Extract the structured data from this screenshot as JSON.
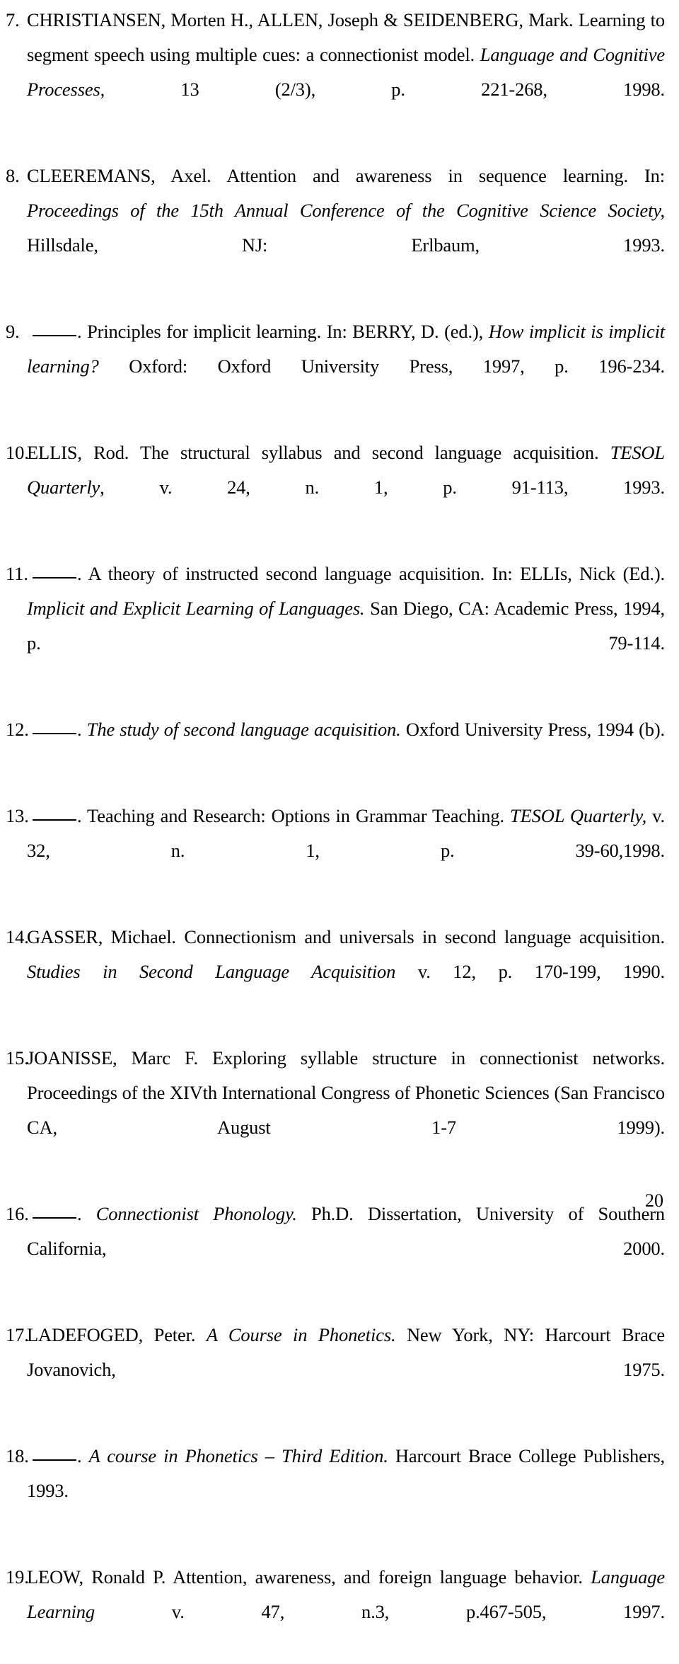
{
  "document": {
    "type": "bibliography",
    "page_number": "20",
    "references": [
      {
        "number": "7.",
        "repeated_author_rule": false,
        "segments": [
          {
            "text": "CHRISTIANSEN, Morten H., ALLEN, Joseph & SEIDENBERG, Mark. Learning to segment speech using multiple cues: a connectionist model. ",
            "style": "roman"
          },
          {
            "text": "Language and Cognitive Processes,",
            "style": "italic"
          },
          {
            "text": " 13 (2/3), p. 221-268, 1998.",
            "style": "roman"
          }
        ]
      },
      {
        "number": "8.",
        "repeated_author_rule": false,
        "segments": [
          {
            "text": "CLEEREMANS, Axel. Attention and awareness in sequence learning. In: ",
            "style": "roman"
          },
          {
            "text": "Proceedings of the 15th Annual Conference of the Cognitive Science Society,",
            "style": "italic"
          },
          {
            "text": " Hillsdale, NJ: Erlbaum, 1993.",
            "style": "roman"
          }
        ]
      },
      {
        "number": "9.",
        "repeated_author_rule": true,
        "segments": [
          {
            "text": ". Principles for implicit learning. In: BERRY, D. (ed.), ",
            "style": "roman"
          },
          {
            "text": "How implicit is implicit learning?",
            "style": "italic"
          },
          {
            "text": " Oxford: Oxford University Press, 1997, p. 196-234.",
            "style": "roman"
          }
        ]
      },
      {
        "number": "10.",
        "repeated_author_rule": false,
        "segments": [
          {
            "text": "ELLIS, Rod. The structural syllabus and second language acquisition. ",
            "style": "roman"
          },
          {
            "text": "TESOL Quarterly",
            "style": "italic"
          },
          {
            "text": ", v. 24, n. 1, p. 91-113, 1993.",
            "style": "roman"
          }
        ]
      },
      {
        "number": "11.",
        "repeated_author_rule": true,
        "segments": [
          {
            "text": ". A theory of instructed second language acquisition. In: ELLIs, Nick (Ed.). ",
            "style": "roman"
          },
          {
            "text": "Implicit and Explicit Learning of Languages.",
            "style": "italic"
          },
          {
            "text": " San Diego, CA: Academic Press, 1994, p. 79-114.",
            "style": "roman"
          }
        ]
      },
      {
        "number": "12.",
        "repeated_author_rule": true,
        "segments": [
          {
            "text": ". ",
            "style": "roman"
          },
          {
            "text": "The study of second language acquisition.",
            "style": "italic"
          },
          {
            "text": "  Oxford University Press, 1994 (b).",
            "style": "roman"
          }
        ]
      },
      {
        "number": "13.",
        "repeated_author_rule": true,
        "segments": [
          {
            "text": ". Teaching and Research: Options in Grammar Teaching. ",
            "style": "roman"
          },
          {
            "text": "TESOL Quarterly,",
            "style": "italic"
          },
          {
            "text": " v. 32, n. 1, p. 39-60,1998.",
            "style": "roman"
          }
        ]
      },
      {
        "number": "14.",
        "repeated_author_rule": false,
        "segments": [
          {
            "text": "GASSER, Michael. Connectionism and universals in second language acquisition. ",
            "style": "roman"
          },
          {
            "text": "Studies in Second Language Acquisition",
            "style": "italic"
          },
          {
            "text": " v. 12, p. 170-199, 1990.",
            "style": "roman"
          }
        ]
      },
      {
        "number": "15.",
        "repeated_author_rule": false,
        "segments": [
          {
            "text": "JOANISSE, Marc F. Exploring syllable structure in connectionist networks. Proceedings of the XIVth International Congress of Phonetic Sciences (San Francisco CA, August 1-7 1999).",
            "style": "roman"
          }
        ]
      },
      {
        "number": "16.",
        "repeated_author_rule": true,
        "segments": [
          {
            "text": ". ",
            "style": "roman"
          },
          {
            "text": "Connectionist Phonology.",
            "style": "italic"
          },
          {
            "text": " Ph.D. Dissertation, University of Southern California, 2000.",
            "style": "roman"
          }
        ]
      },
      {
        "number": "17.",
        "repeated_author_rule": false,
        "segments": [
          {
            "text": "LADEFOGED, Peter. ",
            "style": "roman"
          },
          {
            "text": "A Course in Phonetics.",
            "style": "italic"
          },
          {
            "text": " New York, NY: Harcourt Brace Jovanovich, 1975.",
            "style": "roman"
          }
        ]
      },
      {
        "number": "18.",
        "repeated_author_rule": true,
        "segments": [
          {
            "text": ". ",
            "style": "roman"
          },
          {
            "text": "A course in Phonetics – Third Edition.",
            "style": "italic"
          },
          {
            "text": " Harcourt Brace College Publishers, 1993.",
            "style": "roman"
          }
        ]
      },
      {
        "number": "19.",
        "repeated_author_rule": false,
        "segments": [
          {
            "text": "LEOW, Ronald P. Attention, awareness, and foreign language behavior. ",
            "style": "roman"
          },
          {
            "text": "Language Learning",
            "style": "italic"
          },
          {
            "text": " v. 47, n.3, p.467-505, 1997.",
            "style": "roman"
          }
        ]
      }
    ]
  }
}
